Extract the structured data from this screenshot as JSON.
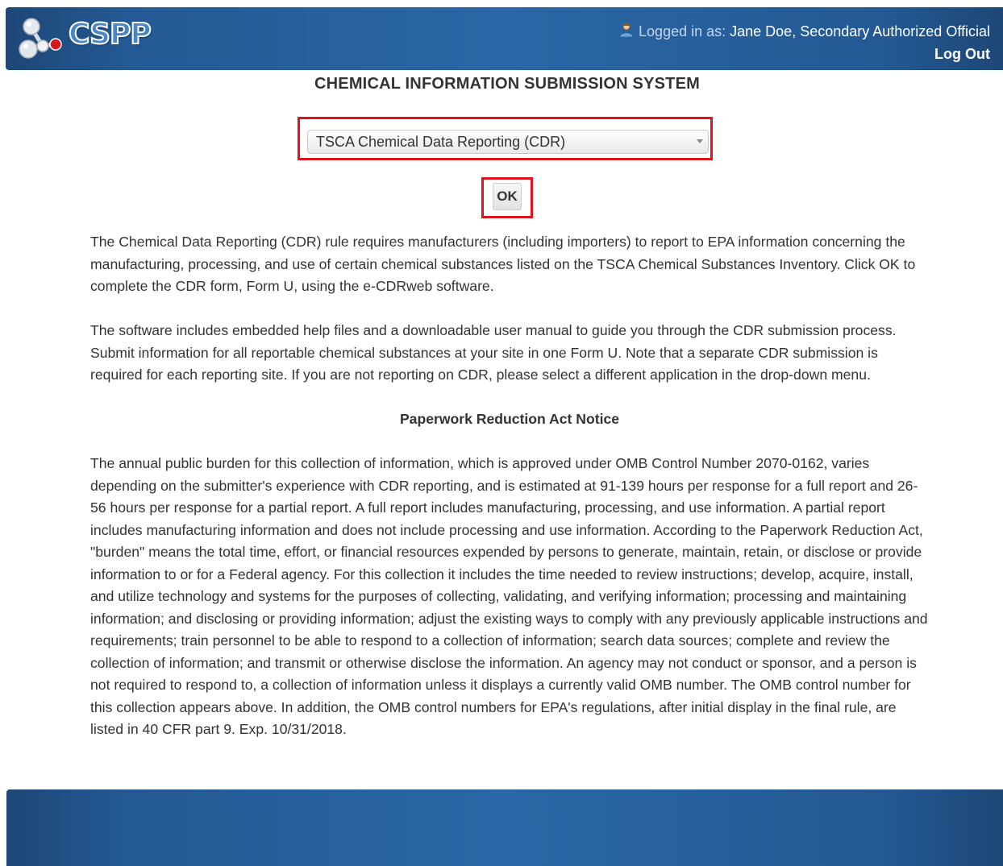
{
  "header": {
    "logo_text": "CSPP",
    "logged_in_label": "Logged in as:",
    "user_name": "Jane Doe, Secondary Authorized Official",
    "logout_label": "Log Out"
  },
  "main": {
    "system_title": "CHEMICAL INFORMATION SUBMISSION SYSTEM",
    "application_select": {
      "selected_value": "TSCA Chemical Data Reporting (CDR)"
    },
    "ok_label": "OK",
    "paragraph_1": "The Chemical Data Reporting (CDR) rule requires manufacturers (including importers) to report to EPA information concerning the manufacturing, processing, and use of certain chemical substances listed on the TSCA Chemical Substances Inventory. Click OK to complete the CDR form, Form U, using the e-CDRweb software.",
    "paragraph_2": "The software includes embedded help files and a downloadable user manual to guide you through the CDR submission process. Submit information for all reportable chemical substances at your site in one Form U. Note that a separate CDR submission is required for each reporting site. If you are not reporting on CDR, please select a different application in the drop-down menu.",
    "notice_title": "Paperwork Reduction Act Notice",
    "notice_text": "The annual public burden for this collection of information, which is approved under OMB Control Number 2070-0162, varies depending on the submitter's experience with CDR reporting, and is estimated at 91-139 hours per response for a full report and 26-56 hours per response for a partial report. A full report includes manufacturing, processing, and use information. A partial report includes manufacturing information and does not include processing and use information. According to the Paperwork Reduction Act, \"burden\" means the total time, effort, or financial resources expended by persons to generate, maintain, retain, or disclose or provide information to or for a Federal agency. For this collection it includes the time needed to review instructions; develop, acquire, install, and utilize technology and systems for the purposes of collecting, validating, and verifying information; processing and maintaining information; and disclosing or providing information; adjust the existing ways to comply with any previously applicable instructions and requirements; train personnel to be able to respond to a collection of information; search data sources; complete and review the collection of information; and transmit or otherwise disclose the information. An agency may not conduct or sponsor, and a person is not required to respond to, a collection of information unless it displays a currently valid OMB number. The OMB control number for this collection appears above. In addition, the OMB control numbers for EPA's regulations, after initial display in the final rule, are listed in 40 CFR part 9. Exp. 10/31/2018."
  },
  "colors": {
    "header_blue": "#235994",
    "highlight_red": "#e0141c",
    "text": "#333333"
  },
  "icons": {
    "logo": "molecule-logo-icon",
    "user": "user-icon"
  }
}
